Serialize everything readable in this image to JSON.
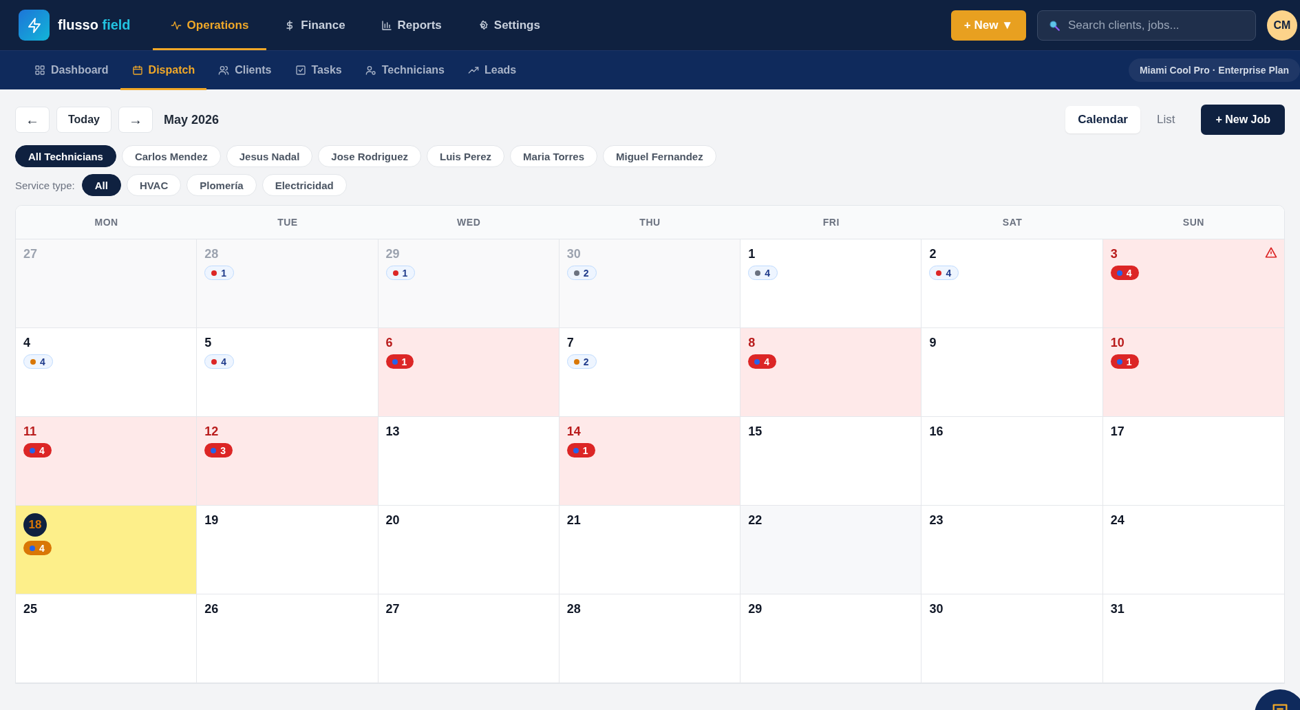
{
  "brand": {
    "name": "flusso",
    "accent": "field"
  },
  "main_nav": [
    {
      "label": "Operations",
      "selected": true
    },
    {
      "label": "Finance",
      "selected": false
    },
    {
      "label": "Reports",
      "selected": false
    },
    {
      "label": "Settings",
      "selected": false
    }
  ],
  "new_button": "+ New ▼",
  "search": {
    "placeholder": "Search clients, jobs..."
  },
  "avatar": "CM",
  "sub_nav": [
    {
      "label": "Dashboard",
      "selected": false
    },
    {
      "label": "Dispatch",
      "selected": true
    },
    {
      "label": "Clients",
      "selected": false
    },
    {
      "label": "Tasks",
      "selected": false
    },
    {
      "label": "Technicians",
      "selected": false
    },
    {
      "label": "Leads",
      "selected": false
    }
  ],
  "org_badge": "Miami Cool Pro · Enterprise Plan",
  "toolbar": {
    "prev": "←",
    "today": "Today",
    "next": "→",
    "month": "May 2026",
    "views": [
      {
        "label": "Calendar",
        "selected": true
      },
      {
        "label": "List",
        "selected": false
      }
    ],
    "new_job": "+ New Job"
  },
  "technicians": [
    {
      "label": "All Technicians",
      "selected": true
    },
    {
      "label": "Carlos Mendez",
      "selected": false
    },
    {
      "label": "Jesus Nadal",
      "selected": false
    },
    {
      "label": "Jose Rodriguez",
      "selected": false
    },
    {
      "label": "Luis Perez",
      "selected": false
    },
    {
      "label": "Maria Torres",
      "selected": false
    },
    {
      "label": "Miguel Fernandez",
      "selected": false
    }
  ],
  "service_filter": {
    "label": "Service type:",
    "options": [
      {
        "label": "All",
        "selected": true
      },
      {
        "label": "HVAC",
        "selected": false
      },
      {
        "label": "Plomería",
        "selected": false
      },
      {
        "label": "Electricidad",
        "selected": false
      }
    ]
  },
  "calendar": {
    "weekdays": [
      "MON",
      "TUE",
      "WED",
      "THU",
      "FRI",
      "SAT",
      "SUN"
    ],
    "days": [
      {
        "day": "27",
        "kind": "outside"
      },
      {
        "day": "28",
        "kind": "outside",
        "badge": {
          "count": "1",
          "color": "#dc2626",
          "kind": "light"
        }
      },
      {
        "day": "29",
        "kind": "outside",
        "badge": {
          "count": "1",
          "color": "#dc2626",
          "kind": "light"
        }
      },
      {
        "day": "30",
        "kind": "outside",
        "badge": {
          "count": "2",
          "color": "#6b7280",
          "kind": "light"
        }
      },
      {
        "day": "1",
        "kind": "normal",
        "badge": {
          "count": "4",
          "color": "#6b7280",
          "kind": "light"
        }
      },
      {
        "day": "2",
        "kind": "normal",
        "badge": {
          "count": "4",
          "color": "#dc2626",
          "kind": "light"
        }
      },
      {
        "day": "3",
        "kind": "alert",
        "warning": true,
        "badge": {
          "count": "4",
          "color": "#2563eb",
          "kind": "alert"
        }
      },
      {
        "day": "4",
        "kind": "normal",
        "badge": {
          "count": "4",
          "color": "#d97706",
          "kind": "light"
        }
      },
      {
        "day": "5",
        "kind": "normal",
        "badge": {
          "count": "4",
          "color": "#dc2626",
          "kind": "light"
        }
      },
      {
        "day": "6",
        "kind": "alert",
        "badge": {
          "count": "1",
          "color": "#2563eb",
          "kind": "alert"
        }
      },
      {
        "day": "7",
        "kind": "normal",
        "badge": {
          "count": "2",
          "color": "#d97706",
          "kind": "light"
        }
      },
      {
        "day": "8",
        "kind": "alert",
        "badge": {
          "count": "4",
          "color": "#2563eb",
          "kind": "alert"
        }
      },
      {
        "day": "9",
        "kind": "normal"
      },
      {
        "day": "10",
        "kind": "alert",
        "badge": {
          "count": "1",
          "color": "#2563eb",
          "kind": "alert"
        }
      },
      {
        "day": "11",
        "kind": "alert",
        "badge": {
          "count": "4",
          "color": "#2563eb",
          "kind": "alert"
        }
      },
      {
        "day": "12",
        "kind": "alert",
        "badge": {
          "count": "3",
          "color": "#2563eb",
          "kind": "alert"
        }
      },
      {
        "day": "13",
        "kind": "normal"
      },
      {
        "day": "14",
        "kind": "alert",
        "badge": {
          "count": "1",
          "color": "#2563eb",
          "kind": "alert"
        }
      },
      {
        "day": "15",
        "kind": "normal"
      },
      {
        "day": "16",
        "kind": "normal"
      },
      {
        "day": "17",
        "kind": "normal"
      },
      {
        "day": "18",
        "kind": "today",
        "badge": {
          "count": "4",
          "color": "#2563eb",
          "kind": "today"
        }
      },
      {
        "day": "19",
        "kind": "normal"
      },
      {
        "day": "20",
        "kind": "normal"
      },
      {
        "day": "21",
        "kind": "normal"
      },
      {
        "day": "22",
        "kind": "hovered"
      },
      {
        "day": "23",
        "kind": "normal"
      },
      {
        "day": "24",
        "kind": "normal"
      },
      {
        "day": "25",
        "kind": "normal"
      },
      {
        "day": "26",
        "kind": "normal"
      },
      {
        "day": "27",
        "kind": "normal"
      },
      {
        "day": "28",
        "kind": "normal"
      },
      {
        "day": "29",
        "kind": "normal"
      },
      {
        "day": "30",
        "kind": "normal"
      },
      {
        "day": "31",
        "kind": "normal"
      }
    ]
  }
}
